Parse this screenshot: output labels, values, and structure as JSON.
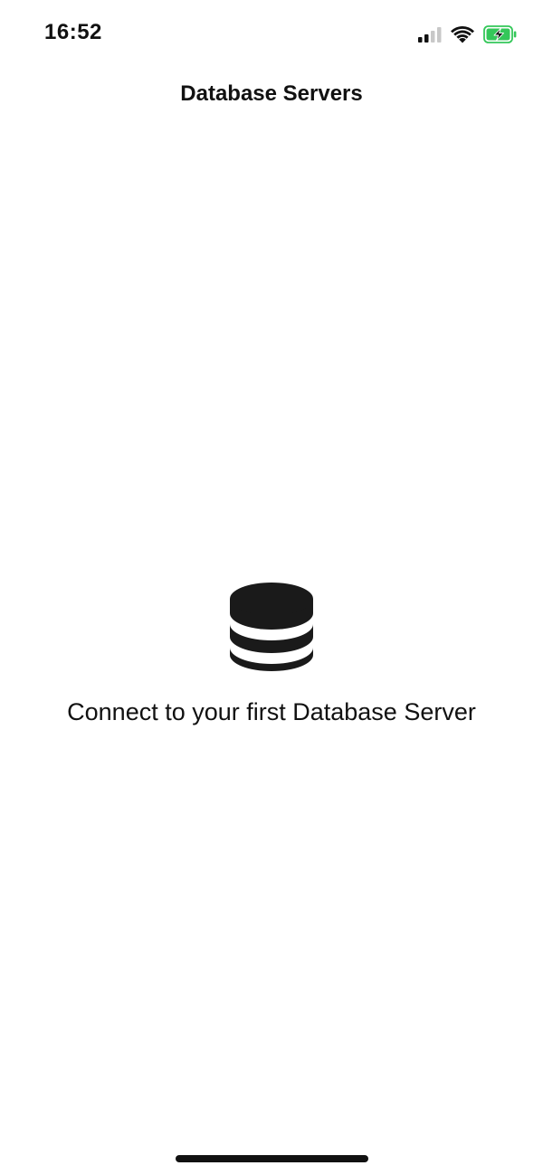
{
  "status_bar": {
    "time": "16:52",
    "signal_icon": "cellular-signal-icon",
    "wifi_icon": "wifi-icon",
    "battery_icon": "battery-charging-icon",
    "battery_color": "#34C759"
  },
  "nav": {
    "title": "Database Servers"
  },
  "empty_state": {
    "icon": "database-icon",
    "message": "Connect to your first Database Server"
  }
}
